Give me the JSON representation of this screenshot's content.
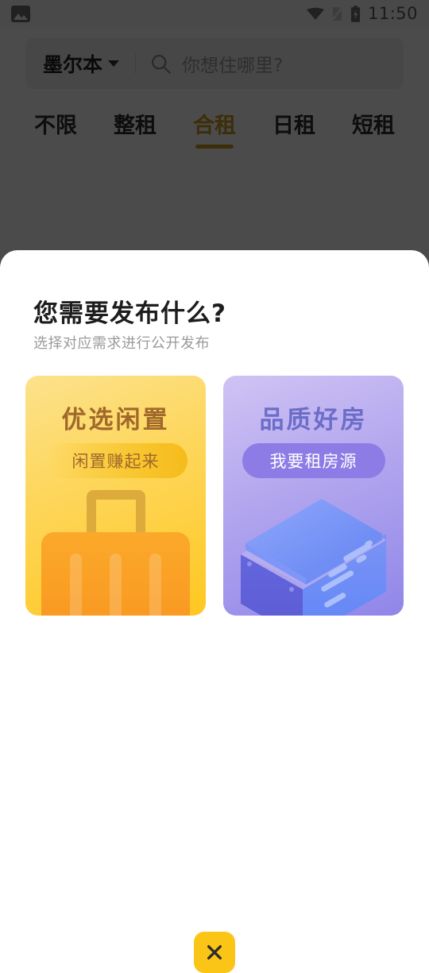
{
  "status_bar": {
    "left_icon": "photo-icon",
    "icons": [
      "wifi-icon",
      "sim-card-off-icon",
      "battery-charging-icon"
    ],
    "time": "11:50"
  },
  "search": {
    "city": "墨尔本",
    "dropdown_icon": "chevron-down-icon",
    "search_icon": "search-icon",
    "placeholder": "你想住哪里?"
  },
  "tabs": {
    "active_index": 2,
    "active_color": "#c89c1e",
    "items": [
      {
        "label": "不限"
      },
      {
        "label": "整租"
      },
      {
        "label": "合租"
      },
      {
        "label": "日租"
      },
      {
        "label": "短租"
      }
    ]
  },
  "sheet": {
    "title": "您需要发布什么?",
    "subtitle": "选择对应需求进行公开发布",
    "cards": [
      {
        "id": "idle-goods",
        "title": "优选闲置",
        "pill": "闲置赚起来",
        "illustration": "suitcase-icon",
        "title_color": "#A0682A",
        "bg_from": "#FCE28C",
        "bg_to": "#FFC721"
      },
      {
        "id": "quality-house",
        "title": "品质好房",
        "pill": "我要租房源",
        "illustration": "isometric-building-icon",
        "title_color": "#6B6DC9",
        "bg_from": "#CFC3F4",
        "bg_to": "#9086E9"
      }
    ]
  },
  "close": {
    "icon": "close-icon",
    "label": "×",
    "color": "#FBC518"
  }
}
